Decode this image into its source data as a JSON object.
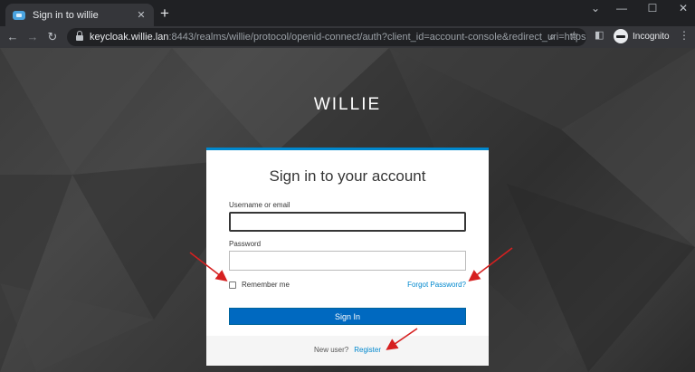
{
  "browser": {
    "tab_title": "Sign in to willie",
    "tab_close": "✕",
    "new_tab": "+",
    "window_controls": [
      "⌄",
      "—",
      "☐",
      "✕"
    ],
    "url_host": "keycloak.willie.lan",
    "url_rest": ":8443/realms/willie/protocol/openid-connect/auth?client_id=account-console&redirect_uri=https%...",
    "profile_label": "Incognito",
    "icons": [
      "back-icon",
      "forward-icon",
      "reload-icon",
      "lock-icon",
      "zoom-icon",
      "bookmark-star-icon",
      "side-panel-icon",
      "incognito-icon",
      "menu-icon"
    ]
  },
  "login": {
    "realm_name": "WILLIE",
    "title": "Sign in to your account",
    "username_label": "Username or email",
    "username_value": "",
    "password_label": "Password",
    "password_value": "",
    "remember_me_label": "Remember me",
    "remember_me_checked": false,
    "forgot_password_link": "Forgot Password?",
    "sign_in_button": "Sign In",
    "new_user_text": "New user?",
    "register_link": "Register"
  },
  "colors": {
    "accent": "#0088ce",
    "button": "#0069c0",
    "annotation_arrow": "#d62020"
  }
}
